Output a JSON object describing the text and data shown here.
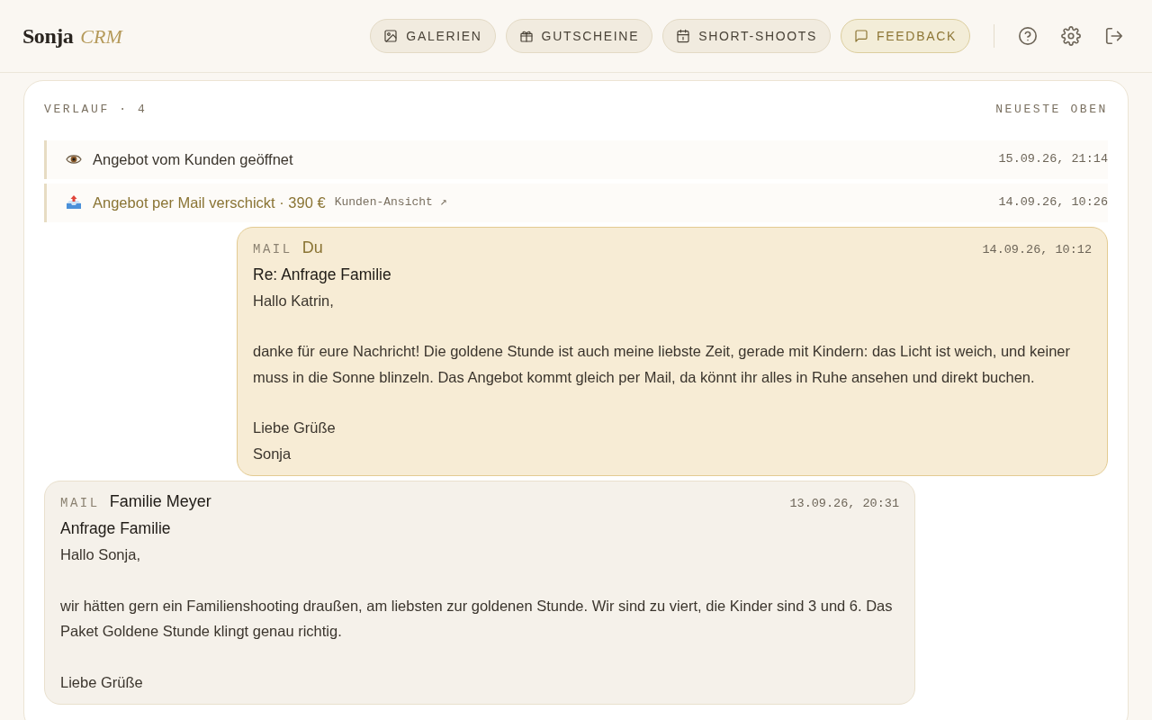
{
  "logo": {
    "name": "Sonja",
    "suffix": "CRM"
  },
  "nav": [
    {
      "label": "GALERIEN",
      "kind": "nav"
    },
    {
      "label": "GUTSCHEINE",
      "kind": "nav"
    },
    {
      "label": "SHORT-SHOOTS",
      "kind": "nav"
    },
    {
      "label": "FEEDBACK",
      "kind": "feedback"
    }
  ],
  "history": {
    "title": "VERLAUF · 4",
    "sort": "NEUESTE OBEN",
    "entries": [
      {
        "kind": "opened",
        "emphasized": false,
        "text": "Angebot vom Kunden geöffnet",
        "time": "15.09.26, 21:14"
      },
      {
        "kind": "sent",
        "emphasized": true,
        "text": "Angebot per Mail verschickt · 390 €",
        "link": "Kunden-Ansicht ↗",
        "time": "14.09.26, 10:26"
      },
      {
        "kind": "outgoing_mail",
        "tag": "MAIL",
        "sender": "Du",
        "time": "14.09.26, 10:12",
        "subject": "Re: Anfrage Familie",
        "body": [
          "Hallo Katrin,",
          "danke für eure Nachricht! Die goldene Stunde ist auch meine liebste Zeit, gerade mit Kindern: das Licht ist weich, und keiner muss in die Sonne blinzeln. Das Angebot kommt gleich per Mail, da könnt ihr alles in Ruhe ansehen und direkt buchen.",
          "Liebe Grüße\nSonja"
        ]
      },
      {
        "kind": "incoming_mail",
        "tag": "MAIL",
        "sender": "Familie Meyer",
        "time": "13.09.26, 20:31",
        "subject": "Anfrage Familie",
        "body": [
          "Hallo Sonja,",
          "wir hätten gern ein Familienshooting draußen, am liebsten zur goldenen Stunde. Wir sind zu viert, die Kinder sind 3 und 6. Das Paket Goldene Stunde klingt genau richtig.",
          "Liebe Grüße"
        ]
      }
    ]
  }
}
